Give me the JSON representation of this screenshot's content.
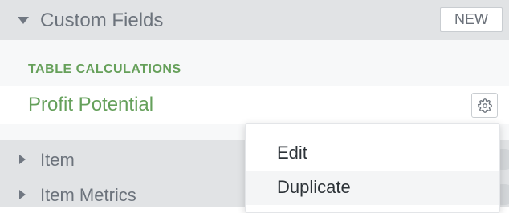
{
  "custom_fields": {
    "title": "Custom Fields",
    "new_button_label": "NEW",
    "table_calculations": {
      "section_label": "TABLE CALCULATIONS",
      "fields": [
        {
          "name": "Profit Potential",
          "options_icon": "gear-icon"
        }
      ]
    }
  },
  "collapsed_sections": [
    {
      "label": "Item"
    },
    {
      "label": "Item Metrics"
    }
  ],
  "field_menu": {
    "items": [
      {
        "label": "Edit"
      },
      {
        "label": "Duplicate"
      }
    ],
    "highlighted_item": "Duplicate"
  },
  "colors": {
    "header_background": "#e1e3e5",
    "field_text_green": "#65a05b",
    "section_label_green": "#66a05a"
  }
}
